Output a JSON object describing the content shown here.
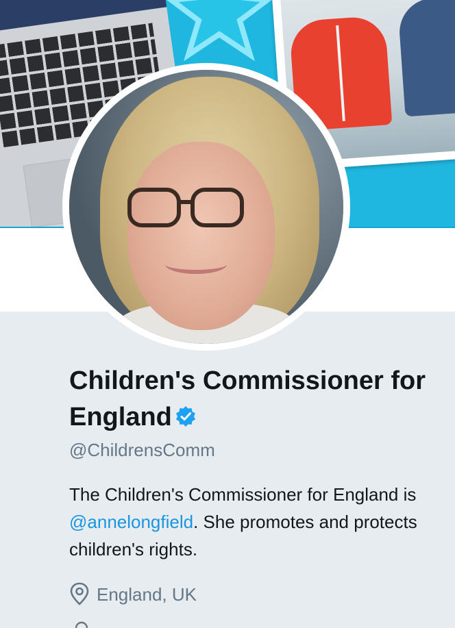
{
  "profile": {
    "name": "Children's Commissioner for England",
    "handle": "@ChildrensComm",
    "verified_icon": "verified-badge-icon",
    "bio": {
      "text_before": "The Children's Commissioner for England is ",
      "mention": "@annelongfield",
      "text_after": ". She promotes and protects children's rights."
    },
    "location": "England, UK",
    "location_icon": "map-pin-icon"
  },
  "colors": {
    "banner": "#1fb6df",
    "page_bg": "#e6ecf0",
    "link": "#1b95e0",
    "verified": "#1da1f2",
    "secondary_text": "#657786"
  }
}
